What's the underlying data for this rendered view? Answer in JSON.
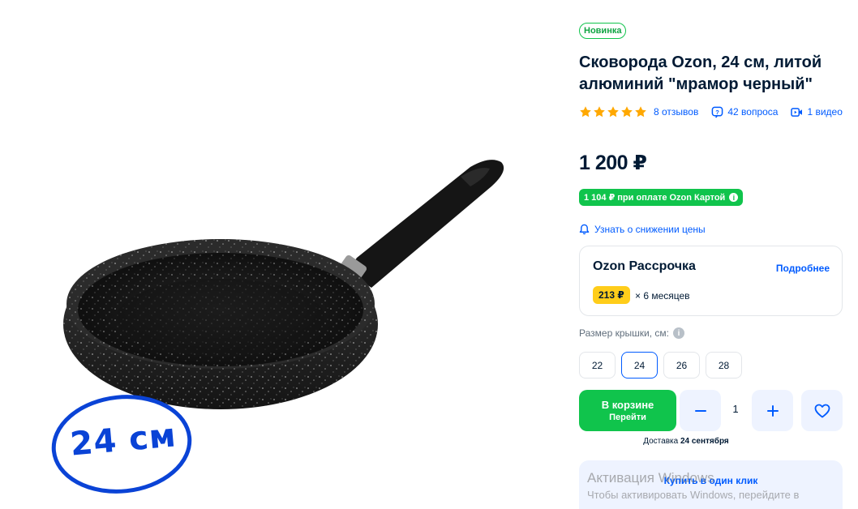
{
  "product": {
    "badge": "Новинка",
    "title": "Сковорода Ozon, 24 см, литой алюминий \"мрамор черный\"",
    "image_badge": "24 см",
    "rating_stars": 5
  },
  "meta": {
    "reviews": "8 отзывов",
    "questions": "42 вопроса",
    "videos": "1 видео"
  },
  "pricing": {
    "price": "1 200 ₽",
    "card_price": "1 104 ₽ при оплате Ozon Картой",
    "notify_label": "Узнать о снижении цены"
  },
  "installment": {
    "title": "Ozon Рассрочка",
    "more_link": "Подробнее",
    "amount": "213 ₽",
    "term": "× 6 месяцев"
  },
  "size_selector": {
    "label": "Размер крышки, см:",
    "options": [
      "22",
      "24",
      "26",
      "28"
    ],
    "selected": "24"
  },
  "cart": {
    "in_cart_label": "В корзине",
    "goto_label": "Перейти",
    "quantity": "1",
    "delivery_prefix": "Доставка",
    "delivery_date": "24 сентября"
  },
  "one_click": {
    "label": "Купить в один клик"
  },
  "os_watermark": {
    "line1": "Активация Windows",
    "line2": "Чтобы активировать Windows, перейдите в"
  },
  "colors": {
    "accent_blue": "#005bff",
    "green": "#10c44c",
    "yellow": "#ffcd1a"
  }
}
